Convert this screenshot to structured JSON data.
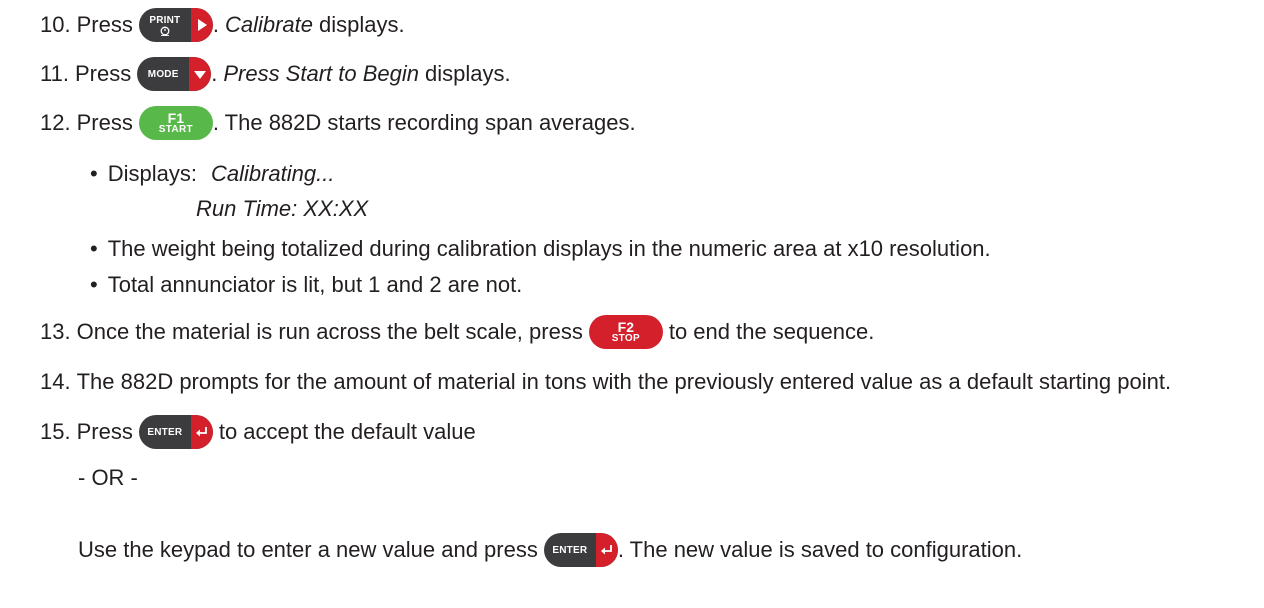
{
  "steps": [
    {
      "num": "10.",
      "pre": "Press",
      "key": "PRINT",
      "dot": ".",
      "em": "Calibrate",
      "post": "displays."
    },
    {
      "num": "11.",
      "pre": "Press",
      "key": "MODE",
      "dot": ".",
      "em": "Press Start to Begin",
      "post": "displays."
    },
    {
      "num": "12.",
      "pre": "Press",
      "key_top": "F1",
      "key_bottom": "START",
      "post": ". The 882D starts recording span averages."
    },
    {
      "num": "13.",
      "pre": "Once the material is run across the belt scale, press",
      "key_top": "F2",
      "key_bottom": "STOP",
      "post": "to end the sequence."
    },
    {
      "num": "14.",
      "text": "The 882D prompts for the amount of material in tons with the previously entered value as a default starting point."
    },
    {
      "num": "15.",
      "pre": "Press",
      "key": "ENTER",
      "post": "to accept the default value"
    }
  ],
  "bullets": {
    "displays_label": "Displays:",
    "displays_line1": "Calibrating...",
    "displays_line2": "Run Time: XX:XX",
    "b2": "The weight being totalized during calibration displays in the numeric area at x10 resolution.",
    "b3": "Total annunciator is lit, but 1 and 2 are not."
  },
  "or_text": "- OR -",
  "final": {
    "pre": "Use the keypad to enter a new value and press",
    "key": "ENTER",
    "post": ". The new value is saved to configuration."
  },
  "bullet_char": "•",
  "colors": {
    "key_dark": "#3c3c3e",
    "key_red": "#d4202b",
    "key_green": "#59b84a",
    "text": "#231f20"
  },
  "icons": {
    "print": "clock-icon",
    "arrow_right": "arrow-right-icon",
    "arrow_down": "arrow-down-icon",
    "enter": "enter-arrow-icon"
  }
}
